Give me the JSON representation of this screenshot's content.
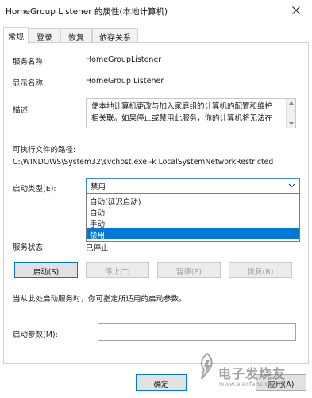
{
  "window": {
    "title": "HomeGroup Listener 的属性(本地计算机)"
  },
  "tabs": [
    {
      "label": "常规",
      "active": true
    },
    {
      "label": "登录",
      "active": false
    },
    {
      "label": "恢复",
      "active": false
    },
    {
      "label": "依存关系",
      "active": false
    }
  ],
  "general": {
    "service_name_label": "服务名称:",
    "service_name_value": "HomeGroupListener",
    "display_name_label": "显示名称:",
    "display_name_value": "HomeGroup Listener",
    "description_label": "描述:",
    "description_lines": [
      "使本地计算机更改与加入家庭组的计算机的配置和维护",
      "相关联。如果停止或禁用此服务，你的计算机将无法在"
    ],
    "exe_path_label": "可执行文件的路径:",
    "exe_path_value": "C:\\WINDOWS\\System32\\svchost.exe -k LocalSystemNetworkRestricted",
    "startup_type_label": "启动类型(E):",
    "startup_type_value": "禁用",
    "startup_type_options": [
      "自动(延迟启动)",
      "自动",
      "手动",
      "禁用"
    ],
    "startup_type_selected_index": 3,
    "service_status_label": "服务状态:",
    "service_status_value": "已停止",
    "buttons": {
      "start": "启动(S)",
      "stop": "停止(T)",
      "pause": "暂停(P)",
      "resume": "恢复(R)"
    },
    "hint": "当从此处启动服务时，你可指定所适用的启动参数。",
    "start_params_label": "启动参数(M):",
    "start_params_value": ""
  },
  "footer": {
    "ok": "确定",
    "apply": "应用(A)"
  },
  "watermark": {
    "brand": "电子发烧友",
    "url": "www.elecfans.com"
  }
}
